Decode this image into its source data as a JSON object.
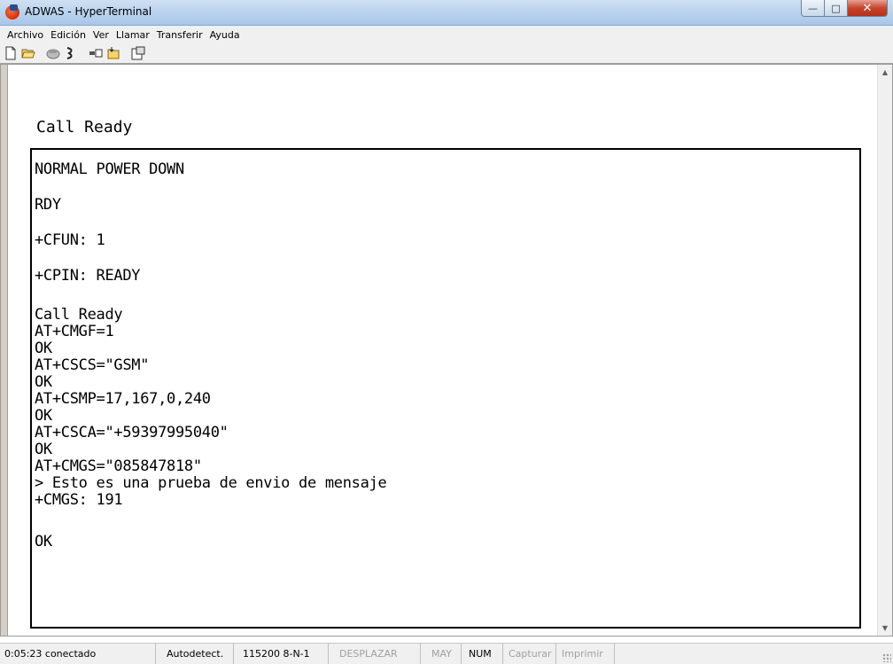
{
  "window": {
    "title": "ADWAS - HyperTerminal",
    "app_icon": "hyperterminal-icon",
    "controls": [
      "minimize-icon",
      "maximize-icon",
      "close-icon"
    ]
  },
  "menu": [
    {
      "label": "Archivo"
    },
    {
      "label": "Edición"
    },
    {
      "label": "Ver"
    },
    {
      "label": "Llamar"
    },
    {
      "label": "Transferir"
    },
    {
      "label": "Ayuda"
    }
  ],
  "toolbar": [
    {
      "icon": "new-document-icon"
    },
    {
      "icon": "open-folder-icon"
    },
    {
      "icon": "call-icon"
    },
    {
      "icon": "disconnect-icon"
    },
    {
      "icon": "send-icon"
    },
    {
      "icon": "receive-icon"
    },
    {
      "icon": "properties-icon"
    }
  ],
  "terminal": {
    "header_line": "Call Ready",
    "lines": [
      "NORMAL POWER DOWN",
      "RDY",
      "+CFUN: 1",
      "+CPIN: READY",
      "Call Ready",
      "AT+CMGF=1",
      "OK",
      "AT+CSCS=\"GSM\"",
      "OK",
      "AT+CSMP=17,167,0,240",
      "OK",
      "AT+CSCA=\"+59397995040\"",
      "OK",
      "AT+CMGS=\"085847818\"",
      "> Esto es una prueba de envio de mensaje",
      "+CMGS: 191",
      "OK"
    ]
  },
  "status": {
    "connection": "0:05:23 conectado",
    "detect": "Autodetect.",
    "port": "115200 8-N-1",
    "scroll": "DESPLAZAR",
    "caps": "MAY",
    "num": "NUM",
    "capture": "Capturar",
    "print": "Imprimir"
  }
}
